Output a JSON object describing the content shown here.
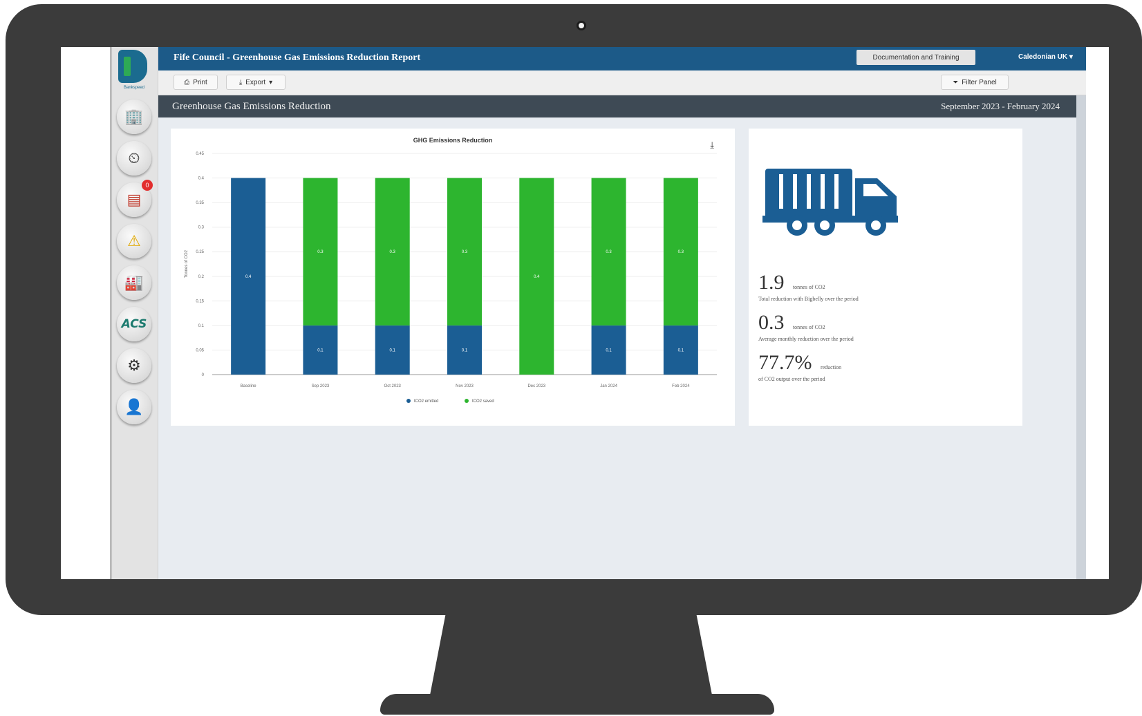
{
  "app": {
    "title": "Fife Council - Greenhouse Gas Emissions Reduction Report",
    "logo_subtext": "Bankspeed",
    "docs_button": "Documentation and Training",
    "user_menu": "Caledonian UK"
  },
  "toolbar": {
    "print_label": "Print",
    "export_label": "Export",
    "filter_label": "Filter Panel"
  },
  "sidebar": {
    "items": [
      {
        "icon": "dashboard-icon"
      },
      {
        "icon": "gauge-icon"
      },
      {
        "icon": "database-icon",
        "badge": "0"
      },
      {
        "icon": "warning-icon"
      },
      {
        "icon": "factory-icon"
      },
      {
        "label": "ACS"
      },
      {
        "icon": "network-icon"
      },
      {
        "icon": "user-settings-icon"
      }
    ]
  },
  "section": {
    "title": "Greenhouse Gas Emissions Reduction",
    "date_range": "September 2023 - February 2024"
  },
  "chart_data": {
    "type": "bar",
    "stacked": true,
    "title": "GHG Emissions Reduction",
    "categories": [
      "Baseline",
      "Sep 2023",
      "Oct 2023",
      "Nov 2023",
      "Dec 2023",
      "Jan 2024",
      "Feb 2024"
    ],
    "series": [
      {
        "name": "tCO2 emitted",
        "color": "#1b5e94",
        "values": [
          0.4,
          0.1,
          0.1,
          0.1,
          0.0,
          0.1,
          0.1
        ]
      },
      {
        "name": "tCO2 saved",
        "color": "#2db52f",
        "values": [
          0.0,
          0.3,
          0.3,
          0.3,
          0.4,
          0.3,
          0.3
        ]
      }
    ],
    "ylim": [
      0,
      0.45
    ],
    "yticks": [
      "0",
      "0.05",
      "0.1",
      "0.15",
      "0.2",
      "0.25",
      "0.3",
      "0.35",
      "0.4",
      "0.45"
    ],
    "ylabel": "Tonnes of CO2",
    "grid": true,
    "legend_position": "bottom"
  },
  "stats": [
    {
      "value": "1.9",
      "unit": "tonnes of CO2",
      "description": "Total reduction with Bigbelly over the period"
    },
    {
      "value": "0.3",
      "unit": "tonnes of CO2",
      "description": "Average monthly reduction over the period"
    },
    {
      "value": "77.7%",
      "unit": "reduction",
      "description": "of CO2 output over the period"
    }
  ],
  "colors": {
    "header": "#1c5a88",
    "section_head": "#3e4a55",
    "emitted": "#1b5e94",
    "saved": "#2db52f",
    "truck": "#1b5e94"
  }
}
